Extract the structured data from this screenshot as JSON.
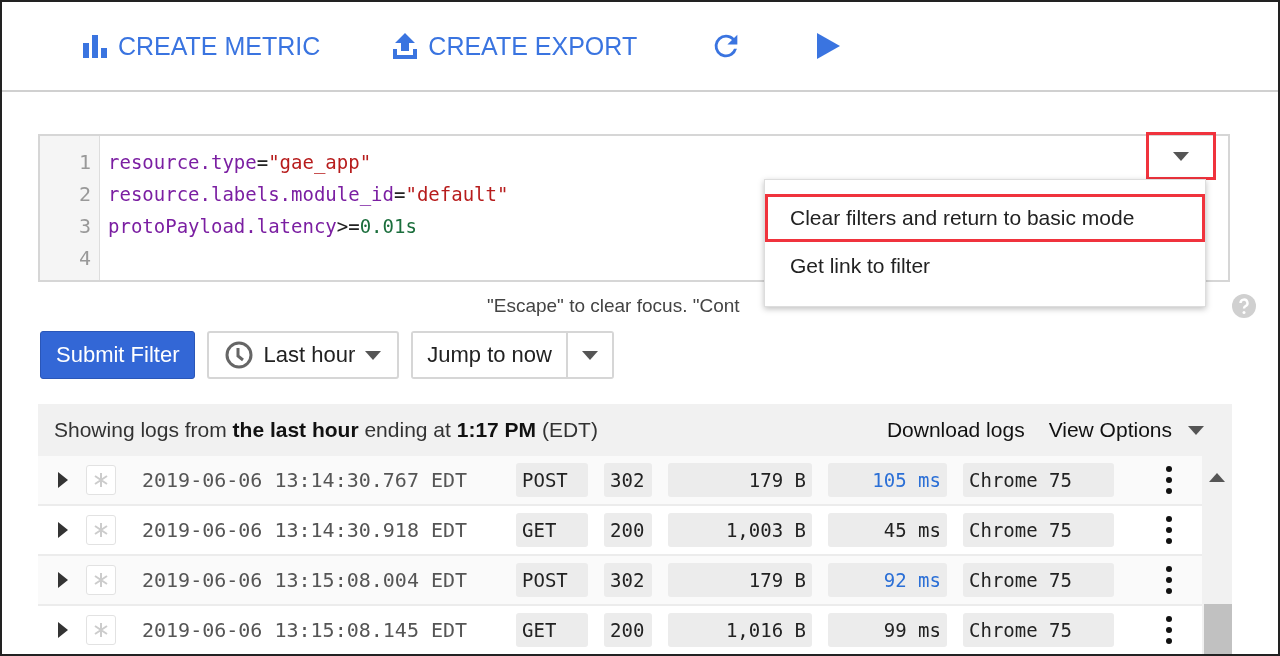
{
  "toolbar": [
    {
      "kind": "metric",
      "label": "CREATE METRIC"
    },
    {
      "kind": "export",
      "label": "CREATE EXPORT"
    },
    {
      "kind": "refresh"
    },
    {
      "kind": "play"
    }
  ],
  "editor": {
    "lines": [
      [
        {
          "kind": "key",
          "s": "resource.type"
        },
        {
          "kind": "op",
          "s": "="
        },
        {
          "kind": "str",
          "s": "\"gae_app\""
        }
      ],
      [
        {
          "kind": "key",
          "s": "resource.labels.module_id"
        },
        {
          "kind": "op",
          "s": "="
        },
        {
          "kind": "str",
          "s": "\"default\""
        }
      ],
      [
        {
          "kind": "key",
          "s": "protoPayload.latency"
        },
        {
          "kind": "op",
          "s": ">="
        },
        {
          "kind": "num",
          "s": "0.01s"
        }
      ]
    ],
    "line_numbers": [
      "1",
      "2",
      "3",
      "4"
    ],
    "dropdown_highlighted": true
  },
  "menu": {
    "items": [
      {
        "label": "Clear filters and return to basic mode",
        "highlighted": true
      },
      {
        "label": "Get link to filter",
        "highlighted": false
      }
    ]
  },
  "hint": "\"Escape\" to clear focus. \"Cont",
  "controls": {
    "submit": "Submit Filter",
    "time_range": "Last hour",
    "jump": "Jump to now"
  },
  "logs": {
    "summary": "Showing logs from **the last hour** ending at **1:17 PM** (EDT)",
    "download": "Download logs",
    "view_options": "View Options",
    "rows": [
      {
        "timestamp": "2019-06-06 13:14:30.767 EDT",
        "method": "POST",
        "status": "302",
        "size": "179 B",
        "latency": "105 ms",
        "slow": true,
        "agent": "Chrome 75"
      },
      {
        "timestamp": "2019-06-06 13:14:30.918 EDT",
        "method": "GET",
        "status": "200",
        "size": "1,003 B",
        "latency": "45 ms",
        "slow": false,
        "agent": "Chrome 75"
      },
      {
        "timestamp": "2019-06-06 13:15:08.004 EDT",
        "method": "POST",
        "status": "302",
        "size": "179 B",
        "latency": "92 ms",
        "slow": true,
        "agent": "Chrome 75"
      },
      {
        "timestamp": "2019-06-06 13:15:08.145 EDT",
        "method": "GET",
        "status": "200",
        "size": "1,016 B",
        "latency": "99 ms",
        "slow": false,
        "agent": "Chrome 75"
      }
    ]
  }
}
